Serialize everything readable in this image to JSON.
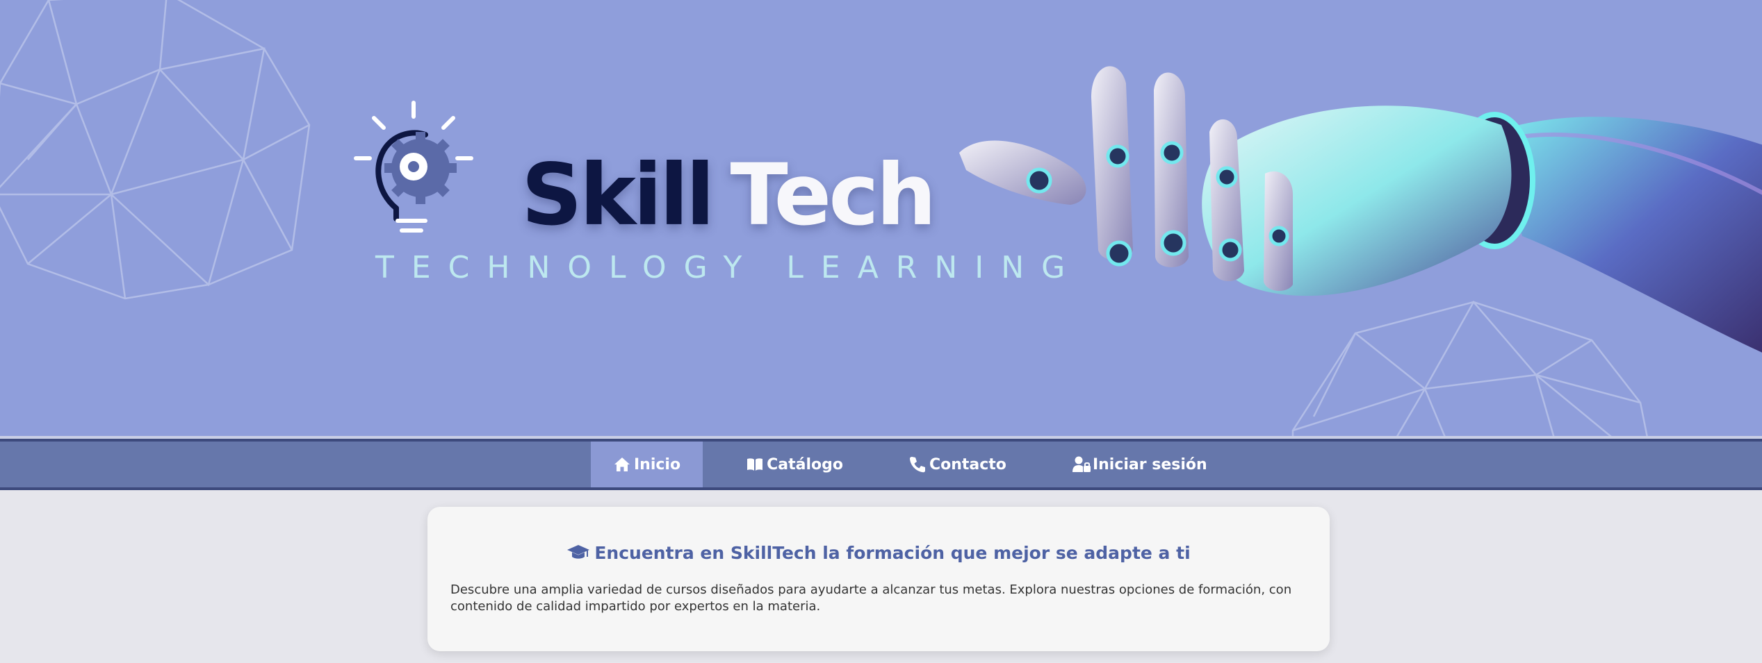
{
  "brand": {
    "word1": "Skill",
    "word2": "Tech",
    "tagline": "TECHNOLOGY LEARNING",
    "logo_icon": "lightbulb-gear-icon"
  },
  "nav": {
    "items": [
      {
        "label": "Inicio",
        "icon": "home-icon",
        "active": true
      },
      {
        "label": "Catálogo",
        "icon": "book-icon",
        "active": false
      },
      {
        "label": "Contacto",
        "icon": "phone-icon",
        "active": false
      },
      {
        "label": "Iniciar sesión",
        "icon": "user-lock-icon",
        "active": false
      }
    ]
  },
  "intro": {
    "icon": "graduation-cap-icon",
    "title": "Encuentra en SkillTech la formación que mejor se adapte a ti",
    "text": "Descubre una amplia variedad de cursos diseñados para ayudarte a alcanzar tus metas. Explora nuestras opciones de formación, con contenido de calidad impartido por expertos en la materia."
  },
  "colors": {
    "banner": "#8f9edb",
    "nav": "#6677ab",
    "nav_active": "#8b99d4",
    "accent_title": "#4e62a4",
    "brand_dark": "#0d1642",
    "tagline": "#bde8ef"
  }
}
